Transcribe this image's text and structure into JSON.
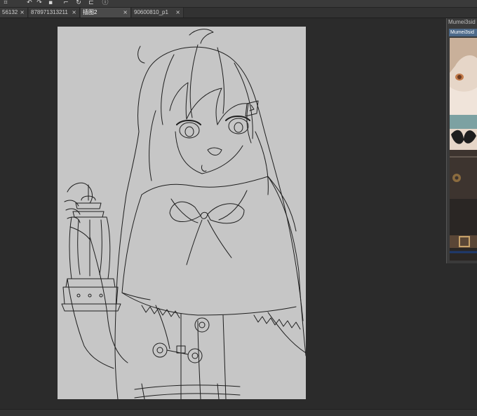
{
  "toolbar": {
    "icons": [
      "frame-icon",
      "undo-icon",
      "redo-icon",
      "layer-icon",
      "transform-icon",
      "rotate-icon",
      "fit-icon",
      "lasso-icon"
    ]
  },
  "tabs": [
    {
      "label": "56132",
      "close": "×",
      "active": false
    },
    {
      "label": "878971313211",
      "close": "×",
      "active": false
    },
    {
      "label": "插图2",
      "close": "×",
      "active": true
    },
    {
      "label": "90600810_p1",
      "close": "×",
      "active": false
    }
  ],
  "reference": {
    "title": "Mumei3sid",
    "subtitle": "Mumei3sid"
  },
  "colors": {
    "canvas": "#c6c6c6",
    "workspace": "#2b2b2b",
    "line": "#1e1e1e"
  }
}
